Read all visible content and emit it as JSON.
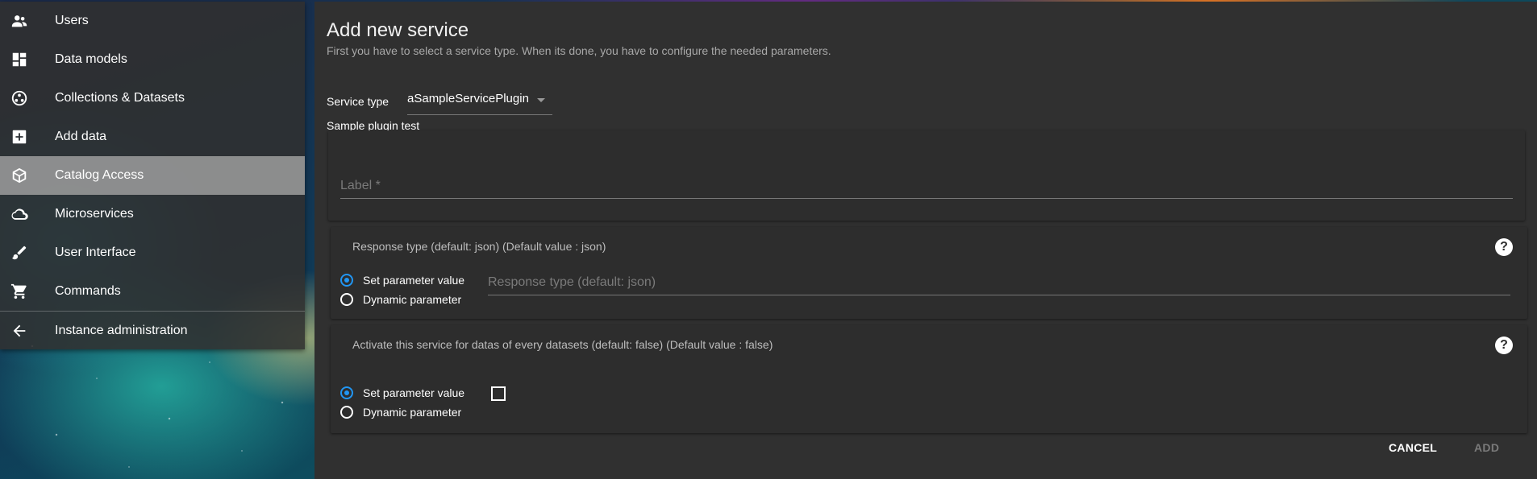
{
  "sidebar": {
    "items": [
      {
        "label": "Users",
        "icon": "users-icon"
      },
      {
        "label": "Data models",
        "icon": "dashboard-icon"
      },
      {
        "label": "Collections & Datasets",
        "icon": "collections-icon"
      },
      {
        "label": "Add data",
        "icon": "add-box-icon"
      },
      {
        "label": "Catalog Access",
        "icon": "cube-icon",
        "active": true
      },
      {
        "label": "Microservices",
        "icon": "cloud-icon"
      },
      {
        "label": "User Interface",
        "icon": "brush-icon"
      },
      {
        "label": "Commands",
        "icon": "cart-icon"
      },
      {
        "label": "Instance administration",
        "icon": "arrow-back-icon"
      }
    ]
  },
  "form": {
    "title": "Add new service",
    "subtitle": "First you have to select a service type. When its done, you have to configure the needed parameters.",
    "service_type_label": "Service type",
    "service_type_value": "aSampleServicePlugin",
    "plugin_title": "Sample plugin test",
    "label_placeholder": "Label *",
    "param1": {
      "title": "Response type (default: json) (Default value : json)",
      "set_label": "Set parameter value",
      "dynamic_label": "Dynamic parameter",
      "input_placeholder": "Response type (default: json)"
    },
    "param2": {
      "title": "Activate this service for datas of every datasets (default: false) (Default value : false)",
      "set_label": "Set parameter value",
      "dynamic_label": "Dynamic parameter"
    },
    "help_glyph": "?",
    "cancel_label": "CANCEL",
    "add_label": "ADD"
  },
  "colors": {
    "accent": "#2196f3",
    "panel": "#303030",
    "active_item": "#9e9e9e"
  }
}
